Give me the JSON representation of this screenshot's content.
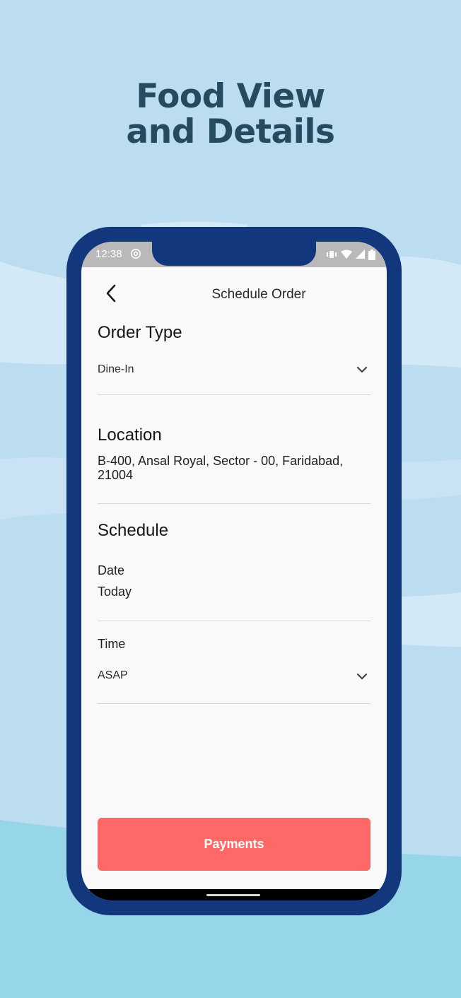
{
  "promo": {
    "title_line1": "Food View",
    "title_line2": "and Details"
  },
  "status_bar": {
    "time": "12:38",
    "icons": [
      "at-sign-icon",
      "vibrate-icon",
      "wifi-icon",
      "signal-icon",
      "battery-icon"
    ]
  },
  "header": {
    "title": "Schedule Order",
    "back_icon": "chevron-left-icon"
  },
  "order_type": {
    "heading": "Order Type",
    "selected": "Dine-In",
    "dropdown_icon": "chevron-down-icon"
  },
  "location": {
    "heading": "Location",
    "line1": "B-400, Ansal Royal, Sector - 00, Faridabad,",
    "line2": "21004"
  },
  "schedule": {
    "heading": "Schedule",
    "date_label": "Date",
    "date_value": "Today",
    "time_label": "Time",
    "time_selected": "ASAP",
    "dropdown_icon": "chevron-down-icon"
  },
  "actions": {
    "payments_label": "Payments"
  },
  "colors": {
    "background": "#bcdcf0",
    "phone_frame": "#13377c",
    "title_text": "#264b5f",
    "payments_button": "#fe6867"
  }
}
